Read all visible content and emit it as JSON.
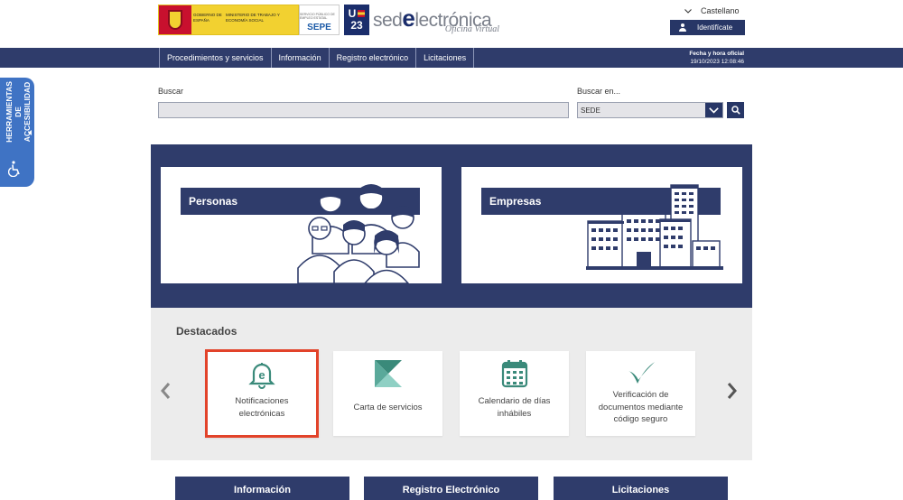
{
  "header": {
    "gov_text_left": "GOBIERNO DE ESPAÑA",
    "gov_text_right": "MINISTERIO DE TRABAJO Y ECONOMÍA SOCIAL",
    "sepe_small": "SERVICIO PÚBLICO DE EMPLEO ESTATAL",
    "sepe_big": "SEPE",
    "ue_line1": "U",
    "ue_line2": "23",
    "sede_prefix": "sed",
    "sede_e": "e",
    "sede_suffix": "lectrónica",
    "sede_sub": "Oficina Virtual",
    "language": "Castellano",
    "identify_label": "Identifícate"
  },
  "nav": {
    "items": [
      {
        "label": "Procedimientos y servicios"
      },
      {
        "label": "Información"
      },
      {
        "label": "Registro electrónico"
      },
      {
        "label": "Licitaciones"
      }
    ],
    "datetime_label": "Fecha y hora oficial",
    "datetime_value": "19/10/2023   12:08:46"
  },
  "accessibility": {
    "label_line1": "HERRAMIENTAS DE",
    "label_line2": "ACCESIBILIDAD"
  },
  "search": {
    "label": "Buscar",
    "value": "",
    "in_label": "Buscar en...",
    "in_selected": "SEDE"
  },
  "hero": {
    "personas_label": "Personas",
    "empresas_label": "Empresas"
  },
  "destacados": {
    "title": "Destacados",
    "tiles": [
      {
        "label_line1": "Notificaciones",
        "label_line2": "electrónicas",
        "icon": "bell-e-icon",
        "selected": true
      },
      {
        "label_line1": "Carta de servicios",
        "label_line2": "",
        "icon": "carta-logo-icon",
        "selected": false
      },
      {
        "label_line1": "Calendario de días",
        "label_line2": "inhábiles",
        "icon": "calendar-icon",
        "selected": false
      },
      {
        "label_line1": "Verificación de",
        "label_line2": "documentos mediante",
        "label_line3": "código seguro",
        "icon": "check-icon",
        "selected": false
      }
    ]
  },
  "bottom": {
    "items": [
      "Información",
      "Registro Electrónico",
      "Licitaciones"
    ]
  },
  "colors": {
    "navy": "#2f3c6b",
    "accent_blue": "#3f73c4",
    "teal": "#3a8a7a",
    "selected_border": "#e2432a"
  }
}
